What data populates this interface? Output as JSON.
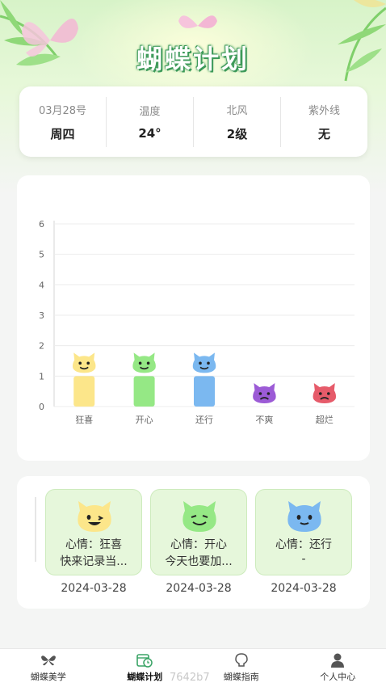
{
  "app": {
    "title": "蝴蝶计划"
  },
  "weather": [
    {
      "label": "03月28号",
      "value": "周四"
    },
    {
      "label": "温度",
      "value": "24°"
    },
    {
      "label": "北风",
      "value": "2级"
    },
    {
      "label": "紫外线",
      "value": "无"
    }
  ],
  "chart_data": {
    "type": "bar",
    "categories": [
      "狂喜",
      "开心",
      "还行",
      "不爽",
      "超烂"
    ],
    "values": [
      1,
      1,
      1,
      0,
      0
    ],
    "yticks": [
      "0",
      "1",
      "2",
      "3",
      "4",
      "5",
      "6"
    ],
    "ylim": [
      0,
      6
    ],
    "grid": true,
    "colors": [
      "#fce68a",
      "#95e885",
      "#7bb8f0",
      "#9c5bd6",
      "#e65b6a"
    ]
  },
  "moods": [
    {
      "mood": "心情：狂喜",
      "note": "快来记录当...",
      "date": "2024-03-28",
      "color": "#fce68a"
    },
    {
      "mood": "心情：开心",
      "note": "今天也要加...",
      "date": "2024-03-28",
      "color": "#95e885"
    },
    {
      "mood": "心情：还行",
      "note": "-",
      "date": "2024-03-28",
      "color": "#7bb8f0"
    }
  ],
  "tabs": [
    {
      "label": "蝴蝶美学",
      "icon": "butterfly-icon",
      "active": false
    },
    {
      "label": "蝴蝶计划",
      "icon": "calendar-clock-icon",
      "active": true
    },
    {
      "label": "蝴蝶指南",
      "icon": "lightbulb-icon",
      "active": false
    },
    {
      "label": "个人中心",
      "icon": "person-icon",
      "active": false
    }
  ],
  "watermark": "7642b7"
}
